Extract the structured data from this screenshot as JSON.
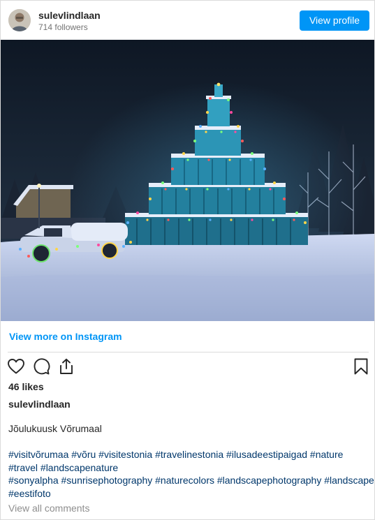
{
  "header": {
    "username": "sulevlindlaan",
    "followers": "714 followers",
    "view_profile_label": "View profile"
  },
  "post": {
    "view_more_label": "View more on Instagram",
    "likes": "46 likes",
    "caption_username": "sulevlindlaan",
    "caption_text": "Jõulukuusk Võrumaal",
    "hashtag_lines": [
      "#visitvõrumaa #võru #visitestonia #travelinestonia #ilusadeestipaigad #nature",
      "#travel #landscapenature",
      "#sonyalpha #sunrisephotography #naturecolors #landscapephotography #landscape",
      "#eestifoto"
    ],
    "view_comments_label": "View all comments"
  },
  "icons": {
    "like": "heart-icon",
    "comment": "comment-icon",
    "share": "share-icon",
    "save": "bookmark-icon"
  },
  "colors": {
    "accent": "#0095f6",
    "hashtag": "#00376b",
    "muted": "#8e8e8e"
  }
}
